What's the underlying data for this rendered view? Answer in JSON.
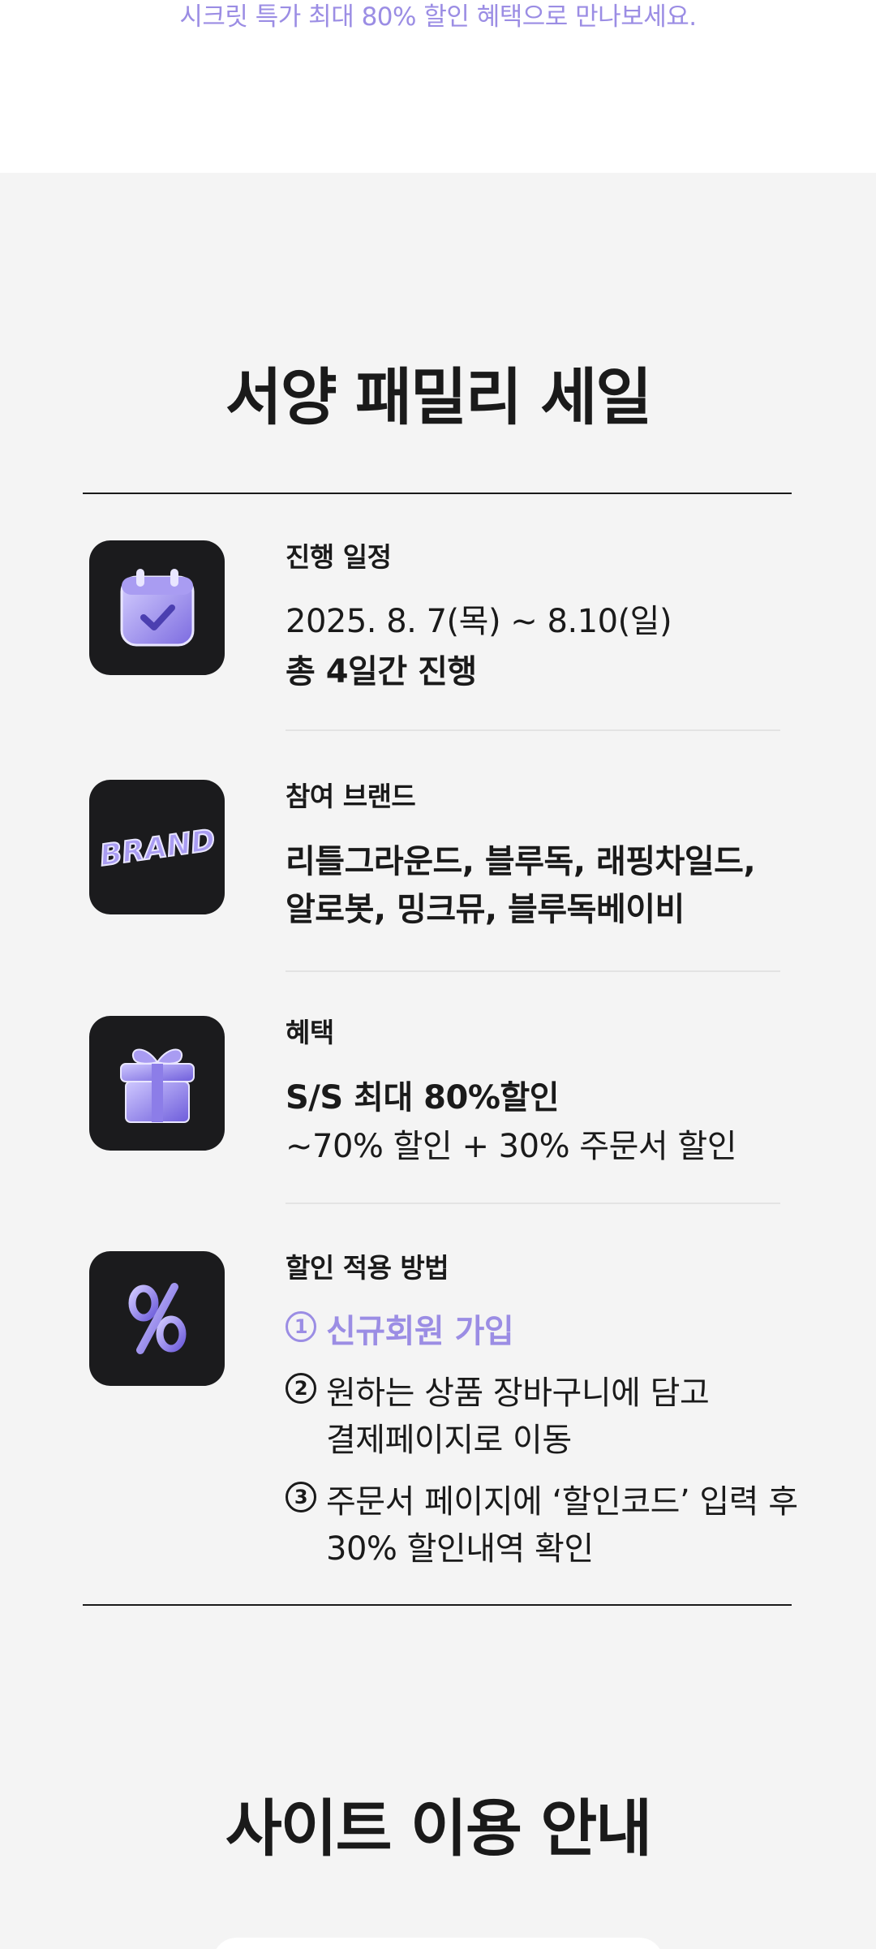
{
  "promo": {
    "text": "시크릿 특가 최대 80% 할인 혜택으로 만나보세요."
  },
  "sale": {
    "title": "서양 패밀리 세일",
    "sections": {
      "schedule": {
        "icon": "calendar-check-icon",
        "label": "진행 일정",
        "date": "2025. 8. 7(목) ~ 8.10(일)",
        "duration": "총 4일간 진행"
      },
      "brands": {
        "icon": "brand-text-icon",
        "icon_text": "BRAND",
        "label": "참여 브랜드",
        "line1": "리틀그라운드, 블루독, 래핑차일드,",
        "line2": "알로봇, 밍크뮤, 블루독베이비"
      },
      "benefit": {
        "icon": "gift-box-icon",
        "label": "혜택",
        "headline": "S/S 최대 80%할인",
        "detail": "~70% 할인 + 30% 주문서 할인"
      },
      "howto": {
        "icon": "percent-icon",
        "label": "할인 적용 방법",
        "steps": [
          {
            "num": "1",
            "text": "신규회원 가입",
            "text2": ""
          },
          {
            "num": "2",
            "text": "원하는 상품 장바구니에 담고",
            "text2": "결제페이지로 이동"
          },
          {
            "num": "3",
            "text": "주문서 페이지에 ‘할인코드’ 입력 후",
            "text2": "30% 할인내역 확인"
          }
        ]
      }
    }
  },
  "site_guide": {
    "title": "사이트 이용 안내"
  },
  "colors": {
    "accent": "#9b8de4",
    "icon_bg": "#1b1b1d",
    "page_bg": "#f4f4f4",
    "text": "#1a1a1a"
  }
}
